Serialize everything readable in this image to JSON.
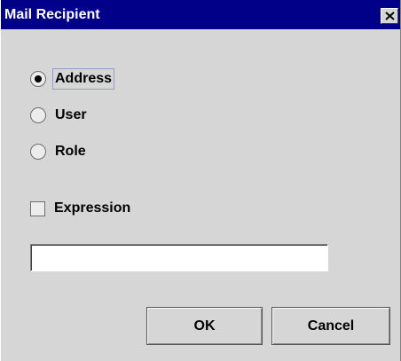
{
  "window": {
    "title": "Mail Recipient",
    "close_icon": "close-x-icon"
  },
  "recipient_type": {
    "options": [
      {
        "label": "Address",
        "checked": true
      },
      {
        "label": "User",
        "checked": false
      },
      {
        "label": "Role",
        "checked": false
      }
    ]
  },
  "expression": {
    "label": "Expression",
    "checked": false
  },
  "recipient_field": {
    "value": "",
    "placeholder": ""
  },
  "buttons": {
    "ok_label": "OK",
    "cancel_label": "Cancel"
  },
  "colors": {
    "titlebar": "#000088",
    "dialog_background": "#d6d6d6",
    "title_text": "#ffffff"
  }
}
